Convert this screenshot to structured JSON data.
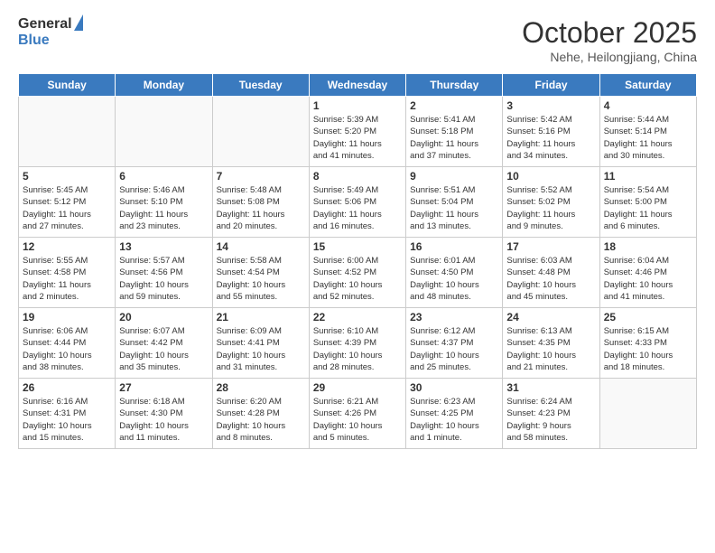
{
  "header": {
    "logo_general": "General",
    "logo_blue": "Blue",
    "month_title": "October 2025",
    "subtitle": "Nehe, Heilongjiang, China"
  },
  "weekdays": [
    "Sunday",
    "Monday",
    "Tuesday",
    "Wednesday",
    "Thursday",
    "Friday",
    "Saturday"
  ],
  "weeks": [
    [
      {
        "num": "",
        "info": ""
      },
      {
        "num": "",
        "info": ""
      },
      {
        "num": "",
        "info": ""
      },
      {
        "num": "1",
        "info": "Sunrise: 5:39 AM\nSunset: 5:20 PM\nDaylight: 11 hours\nand 41 minutes."
      },
      {
        "num": "2",
        "info": "Sunrise: 5:41 AM\nSunset: 5:18 PM\nDaylight: 11 hours\nand 37 minutes."
      },
      {
        "num": "3",
        "info": "Sunrise: 5:42 AM\nSunset: 5:16 PM\nDaylight: 11 hours\nand 34 minutes."
      },
      {
        "num": "4",
        "info": "Sunrise: 5:44 AM\nSunset: 5:14 PM\nDaylight: 11 hours\nand 30 minutes."
      }
    ],
    [
      {
        "num": "5",
        "info": "Sunrise: 5:45 AM\nSunset: 5:12 PM\nDaylight: 11 hours\nand 27 minutes."
      },
      {
        "num": "6",
        "info": "Sunrise: 5:46 AM\nSunset: 5:10 PM\nDaylight: 11 hours\nand 23 minutes."
      },
      {
        "num": "7",
        "info": "Sunrise: 5:48 AM\nSunset: 5:08 PM\nDaylight: 11 hours\nand 20 minutes."
      },
      {
        "num": "8",
        "info": "Sunrise: 5:49 AM\nSunset: 5:06 PM\nDaylight: 11 hours\nand 16 minutes."
      },
      {
        "num": "9",
        "info": "Sunrise: 5:51 AM\nSunset: 5:04 PM\nDaylight: 11 hours\nand 13 minutes."
      },
      {
        "num": "10",
        "info": "Sunrise: 5:52 AM\nSunset: 5:02 PM\nDaylight: 11 hours\nand 9 minutes."
      },
      {
        "num": "11",
        "info": "Sunrise: 5:54 AM\nSunset: 5:00 PM\nDaylight: 11 hours\nand 6 minutes."
      }
    ],
    [
      {
        "num": "12",
        "info": "Sunrise: 5:55 AM\nSunset: 4:58 PM\nDaylight: 11 hours\nand 2 minutes."
      },
      {
        "num": "13",
        "info": "Sunrise: 5:57 AM\nSunset: 4:56 PM\nDaylight: 10 hours\nand 59 minutes."
      },
      {
        "num": "14",
        "info": "Sunrise: 5:58 AM\nSunset: 4:54 PM\nDaylight: 10 hours\nand 55 minutes."
      },
      {
        "num": "15",
        "info": "Sunrise: 6:00 AM\nSunset: 4:52 PM\nDaylight: 10 hours\nand 52 minutes."
      },
      {
        "num": "16",
        "info": "Sunrise: 6:01 AM\nSunset: 4:50 PM\nDaylight: 10 hours\nand 48 minutes."
      },
      {
        "num": "17",
        "info": "Sunrise: 6:03 AM\nSunset: 4:48 PM\nDaylight: 10 hours\nand 45 minutes."
      },
      {
        "num": "18",
        "info": "Sunrise: 6:04 AM\nSunset: 4:46 PM\nDaylight: 10 hours\nand 41 minutes."
      }
    ],
    [
      {
        "num": "19",
        "info": "Sunrise: 6:06 AM\nSunset: 4:44 PM\nDaylight: 10 hours\nand 38 minutes."
      },
      {
        "num": "20",
        "info": "Sunrise: 6:07 AM\nSunset: 4:42 PM\nDaylight: 10 hours\nand 35 minutes."
      },
      {
        "num": "21",
        "info": "Sunrise: 6:09 AM\nSunset: 4:41 PM\nDaylight: 10 hours\nand 31 minutes."
      },
      {
        "num": "22",
        "info": "Sunrise: 6:10 AM\nSunset: 4:39 PM\nDaylight: 10 hours\nand 28 minutes."
      },
      {
        "num": "23",
        "info": "Sunrise: 6:12 AM\nSunset: 4:37 PM\nDaylight: 10 hours\nand 25 minutes."
      },
      {
        "num": "24",
        "info": "Sunrise: 6:13 AM\nSunset: 4:35 PM\nDaylight: 10 hours\nand 21 minutes."
      },
      {
        "num": "25",
        "info": "Sunrise: 6:15 AM\nSunset: 4:33 PM\nDaylight: 10 hours\nand 18 minutes."
      }
    ],
    [
      {
        "num": "26",
        "info": "Sunrise: 6:16 AM\nSunset: 4:31 PM\nDaylight: 10 hours\nand 15 minutes."
      },
      {
        "num": "27",
        "info": "Sunrise: 6:18 AM\nSunset: 4:30 PM\nDaylight: 10 hours\nand 11 minutes."
      },
      {
        "num": "28",
        "info": "Sunrise: 6:20 AM\nSunset: 4:28 PM\nDaylight: 10 hours\nand 8 minutes."
      },
      {
        "num": "29",
        "info": "Sunrise: 6:21 AM\nSunset: 4:26 PM\nDaylight: 10 hours\nand 5 minutes."
      },
      {
        "num": "30",
        "info": "Sunrise: 6:23 AM\nSunset: 4:25 PM\nDaylight: 10 hours\nand 1 minute."
      },
      {
        "num": "31",
        "info": "Sunrise: 6:24 AM\nSunset: 4:23 PM\nDaylight: 9 hours\nand 58 minutes."
      },
      {
        "num": "",
        "info": ""
      }
    ]
  ]
}
